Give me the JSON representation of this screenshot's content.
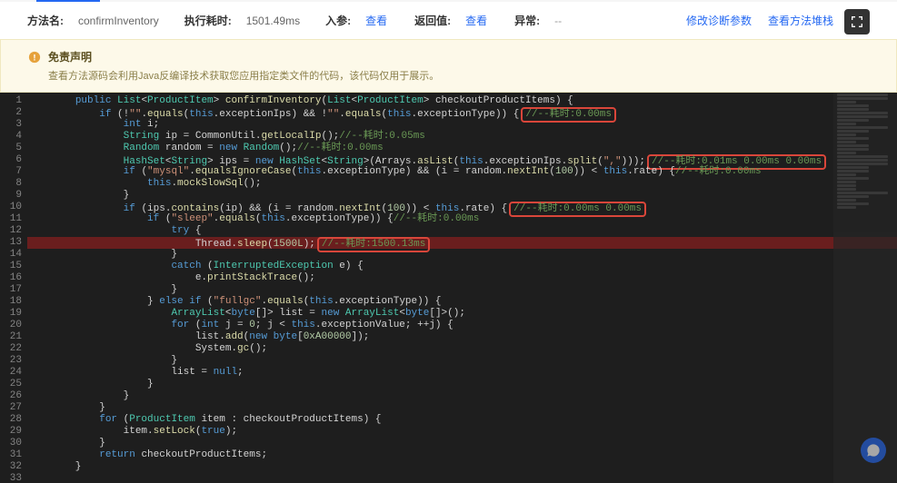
{
  "header": {
    "method_label": "方法名:",
    "method_value": "confirmInventory",
    "exec_label": "执行耗时:",
    "exec_value": "1501.49ms",
    "param_label": "入参:",
    "view1": "查看",
    "return_label": "返回值:",
    "view2": "查看",
    "exception_label": "异常:",
    "exception_value": "--",
    "link_modify": "修改诊断参数",
    "link_view": "查看方法堆栈"
  },
  "notice": {
    "title": "免责声明",
    "desc": "查看方法源码会利用Java反编译技术获取您应用指定类文件的代码，该代码仅用于展示。"
  },
  "code": {
    "lines": [
      {
        "n": 1,
        "indent": 2,
        "segs": [
          {
            "t": "public ",
            "c": "kw"
          },
          {
            "t": "List",
            "c": "typ"
          },
          {
            "t": "<"
          },
          {
            "t": "ProductItem",
            "c": "typ"
          },
          {
            "t": "> "
          },
          {
            "t": "confirmInventory",
            "c": "mth"
          },
          {
            "t": "("
          },
          {
            "t": "List",
            "c": "typ"
          },
          {
            "t": "<"
          },
          {
            "t": "ProductItem",
            "c": "typ"
          },
          {
            "t": "> checkoutProductItems) {"
          }
        ]
      },
      {
        "n": 2,
        "indent": 3,
        "segs": [
          {
            "t": "if ",
            "c": "kw"
          },
          {
            "t": "(!"
          },
          {
            "t": "\"\"",
            "c": "str"
          },
          {
            "t": "."
          },
          {
            "t": "equals",
            "c": "mth"
          },
          {
            "t": "("
          },
          {
            "t": "this",
            "c": "kw"
          },
          {
            "t": ".exceptionIps) && !"
          },
          {
            "t": "\"\"",
            "c": "str"
          },
          {
            "t": "."
          },
          {
            "t": "equals",
            "c": "mth"
          },
          {
            "t": "("
          },
          {
            "t": "this",
            "c": "kw"
          },
          {
            "t": ".exceptionType)) {"
          }
        ],
        "box": "//--耗时:0.00ms"
      },
      {
        "n": 3,
        "indent": 4,
        "segs": [
          {
            "t": "int ",
            "c": "kw"
          },
          {
            "t": "i;"
          }
        ]
      },
      {
        "n": 4,
        "indent": 4,
        "segs": [
          {
            "t": "String ",
            "c": "typ"
          },
          {
            "t": "ip = CommonUtil."
          },
          {
            "t": "getLocalIp",
            "c": "mth"
          },
          {
            "t": "();"
          },
          {
            "t": "//--耗时:0.05ms",
            "c": "cmt"
          }
        ]
      },
      {
        "n": 5,
        "indent": 4,
        "segs": [
          {
            "t": "Random ",
            "c": "typ"
          },
          {
            "t": "random = "
          },
          {
            "t": "new ",
            "c": "kw"
          },
          {
            "t": "Random",
            "c": "typ"
          },
          {
            "t": "();"
          },
          {
            "t": "//--耗时:0.00ms",
            "c": "cmt"
          }
        ]
      },
      {
        "n": 6,
        "indent": 4,
        "segs": [
          {
            "t": "HashSet",
            "c": "typ"
          },
          {
            "t": "<"
          },
          {
            "t": "String",
            "c": "typ"
          },
          {
            "t": "> ips = "
          },
          {
            "t": "new ",
            "c": "kw"
          },
          {
            "t": "HashSet",
            "c": "typ"
          },
          {
            "t": "<"
          },
          {
            "t": "String",
            "c": "typ"
          },
          {
            "t": ">(Arrays."
          },
          {
            "t": "asList",
            "c": "mth"
          },
          {
            "t": "("
          },
          {
            "t": "this",
            "c": "kw"
          },
          {
            "t": ".exceptionIps."
          },
          {
            "t": "split",
            "c": "mth"
          },
          {
            "t": "("
          },
          {
            "t": "\",\"",
            "c": "str"
          },
          {
            "t": ")));"
          }
        ],
        "box": "//--耗时:0.01ms 0.00ms 0.00ms"
      },
      {
        "n": 7,
        "indent": 4,
        "segs": [
          {
            "t": "if ",
            "c": "kw"
          },
          {
            "t": "("
          },
          {
            "t": "\"mysql\"",
            "c": "str"
          },
          {
            "t": "."
          },
          {
            "t": "equalsIgnoreCase",
            "c": "mth"
          },
          {
            "t": "("
          },
          {
            "t": "this",
            "c": "kw"
          },
          {
            "t": ".exceptionType) && (i = random."
          },
          {
            "t": "nextInt",
            "c": "mth"
          },
          {
            "t": "("
          },
          {
            "t": "100",
            "c": "num"
          },
          {
            "t": ")) < "
          },
          {
            "t": "this",
            "c": "kw"
          },
          {
            "t": ".rate) {"
          },
          {
            "t": "//--耗时:0.00ms",
            "c": "cmt"
          }
        ]
      },
      {
        "n": 8,
        "indent": 5,
        "segs": [
          {
            "t": "this",
            "c": "kw"
          },
          {
            "t": "."
          },
          {
            "t": "mockSlowSql",
            "c": "mth"
          },
          {
            "t": "();"
          }
        ]
      },
      {
        "n": 9,
        "indent": 4,
        "segs": [
          {
            "t": "}"
          }
        ]
      },
      {
        "n": 10,
        "indent": 4,
        "segs": [
          {
            "t": "if ",
            "c": "kw"
          },
          {
            "t": "(ips."
          },
          {
            "t": "contains",
            "c": "mth"
          },
          {
            "t": "(ip) && (i = random."
          },
          {
            "t": "nextInt",
            "c": "mth"
          },
          {
            "t": "("
          },
          {
            "t": "100",
            "c": "num"
          },
          {
            "t": ")) < "
          },
          {
            "t": "this",
            "c": "kw"
          },
          {
            "t": ".rate) {"
          }
        ],
        "box": "//--耗时:0.00ms 0.00ms"
      },
      {
        "n": 11,
        "indent": 5,
        "segs": [
          {
            "t": "if ",
            "c": "kw"
          },
          {
            "t": "("
          },
          {
            "t": "\"sleep\"",
            "c": "str"
          },
          {
            "t": "."
          },
          {
            "t": "equals",
            "c": "mth"
          },
          {
            "t": "("
          },
          {
            "t": "this",
            "c": "kw"
          },
          {
            "t": ".exceptionType)) {"
          },
          {
            "t": "//--耗时:0.00ms",
            "c": "cmt"
          }
        ]
      },
      {
        "n": 12,
        "indent": 6,
        "segs": [
          {
            "t": "try ",
            "c": "kw"
          },
          {
            "t": "{"
          }
        ]
      },
      {
        "n": 13,
        "indent": 7,
        "hl": true,
        "segs": [
          {
            "t": "Thread."
          },
          {
            "t": "sleep",
            "c": "mth"
          },
          {
            "t": "("
          },
          {
            "t": "1500L",
            "c": "num"
          },
          {
            "t": ");"
          }
        ],
        "box": "//--耗时:1500.13ms"
      },
      {
        "n": 14,
        "indent": 6,
        "segs": [
          {
            "t": "}"
          }
        ]
      },
      {
        "n": 15,
        "indent": 6,
        "segs": [
          {
            "t": "catch ",
            "c": "kw"
          },
          {
            "t": "("
          },
          {
            "t": "InterruptedException",
            "c": "typ"
          },
          {
            "t": " e) {"
          }
        ]
      },
      {
        "n": 16,
        "indent": 7,
        "segs": [
          {
            "t": "e."
          },
          {
            "t": "printStackTrace",
            "c": "mth"
          },
          {
            "t": "();"
          }
        ]
      },
      {
        "n": 17,
        "indent": 6,
        "segs": [
          {
            "t": "}"
          }
        ]
      },
      {
        "n": 18,
        "indent": 5,
        "segs": [
          {
            "t": "} "
          },
          {
            "t": "else if ",
            "c": "kw"
          },
          {
            "t": "("
          },
          {
            "t": "\"fullgc\"",
            "c": "str"
          },
          {
            "t": "."
          },
          {
            "t": "equals",
            "c": "mth"
          },
          {
            "t": "("
          },
          {
            "t": "this",
            "c": "kw"
          },
          {
            "t": ".exceptionType)) {"
          }
        ]
      },
      {
        "n": 19,
        "indent": 6,
        "segs": [
          {
            "t": "ArrayList",
            "c": "typ"
          },
          {
            "t": "<"
          },
          {
            "t": "byte",
            "c": "kw"
          },
          {
            "t": "[]> list = "
          },
          {
            "t": "new ",
            "c": "kw"
          },
          {
            "t": "ArrayList",
            "c": "typ"
          },
          {
            "t": "<"
          },
          {
            "t": "byte",
            "c": "kw"
          },
          {
            "t": "[]>();"
          }
        ]
      },
      {
        "n": 20,
        "indent": 6,
        "segs": [
          {
            "t": "for ",
            "c": "kw"
          },
          {
            "t": "("
          },
          {
            "t": "int ",
            "c": "kw"
          },
          {
            "t": "j = "
          },
          {
            "t": "0",
            "c": "num"
          },
          {
            "t": "; j < "
          },
          {
            "t": "this",
            "c": "kw"
          },
          {
            "t": ".exceptionValue; ++j) {"
          }
        ]
      },
      {
        "n": 21,
        "indent": 7,
        "segs": [
          {
            "t": "list."
          },
          {
            "t": "add",
            "c": "mth"
          },
          {
            "t": "("
          },
          {
            "t": "new ",
            "c": "kw"
          },
          {
            "t": "byte",
            "c": "kw"
          },
          {
            "t": "["
          },
          {
            "t": "0xA00000",
            "c": "num"
          },
          {
            "t": "]);"
          }
        ]
      },
      {
        "n": 22,
        "indent": 7,
        "segs": [
          {
            "t": "System."
          },
          {
            "t": "gc",
            "c": "mth"
          },
          {
            "t": "();"
          }
        ]
      },
      {
        "n": 23,
        "indent": 6,
        "segs": [
          {
            "t": "}"
          }
        ]
      },
      {
        "n": 24,
        "indent": 6,
        "segs": [
          {
            "t": "list = "
          },
          {
            "t": "null",
            "c": "kw"
          },
          {
            "t": ";"
          }
        ]
      },
      {
        "n": 25,
        "indent": 5,
        "segs": [
          {
            "t": "}"
          }
        ]
      },
      {
        "n": 26,
        "indent": 4,
        "segs": [
          {
            "t": "}"
          }
        ]
      },
      {
        "n": 27,
        "indent": 3,
        "segs": [
          {
            "t": "}"
          }
        ]
      },
      {
        "n": 28,
        "indent": 3,
        "segs": [
          {
            "t": "for ",
            "c": "kw"
          },
          {
            "t": "("
          },
          {
            "t": "ProductItem",
            "c": "typ"
          },
          {
            "t": " item : checkoutProductItems) {"
          }
        ]
      },
      {
        "n": 29,
        "indent": 4,
        "segs": [
          {
            "t": "item."
          },
          {
            "t": "setLock",
            "c": "mth"
          },
          {
            "t": "("
          },
          {
            "t": "true",
            "c": "kw"
          },
          {
            "t": ");"
          }
        ]
      },
      {
        "n": 30,
        "indent": 3,
        "segs": [
          {
            "t": "}"
          }
        ]
      },
      {
        "n": 31,
        "indent": 3,
        "segs": [
          {
            "t": "return ",
            "c": "kw"
          },
          {
            "t": "checkoutProductItems;"
          }
        ]
      },
      {
        "n": 32,
        "indent": 2,
        "segs": [
          {
            "t": "}"
          }
        ]
      },
      {
        "n": 33,
        "indent": 0,
        "segs": []
      }
    ]
  }
}
